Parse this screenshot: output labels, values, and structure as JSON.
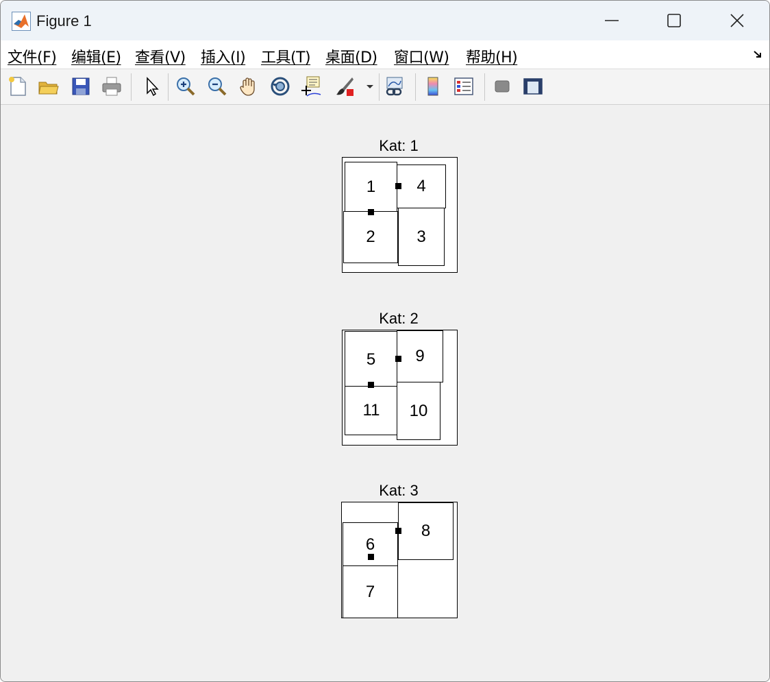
{
  "window": {
    "title": "Figure 1"
  },
  "menu": [
    {
      "id": "file",
      "label": "文件(F)"
    },
    {
      "id": "edit",
      "label": "编辑(E)"
    },
    {
      "id": "view",
      "label": "查看(V)"
    },
    {
      "id": "insert",
      "label": "插入(I)"
    },
    {
      "id": "tools",
      "label": "工具(T)"
    },
    {
      "id": "desktop",
      "label": "桌面(D)"
    },
    {
      "id": "window",
      "label": "窗口(W)"
    },
    {
      "id": "help",
      "label": "帮助(H)"
    }
  ],
  "toolbar_icons": [
    "new-figure-icon",
    "open-file-icon",
    "save-icon",
    "print-icon",
    "edit-plot-arrow-icon",
    "zoom-in-icon",
    "zoom-out-icon",
    "pan-hand-icon",
    "rotate-3d-icon",
    "data-cursor-icon",
    "brush-icon",
    "brush-dropdown-icon",
    "link-plot-icon",
    "colorbar-icon",
    "legend-icon",
    "hide-plot-tools-icon",
    "show-plot-tools-icon"
  ],
  "colors": {
    "titlebar": "#eef3f8",
    "canvas": "#f0f0f0",
    "brush_red": "#e02020"
  },
  "panels": [
    {
      "title": "Kat: 1",
      "tiles": [
        "1",
        "4",
        "2",
        "3"
      ]
    },
    {
      "title": "Kat: 2",
      "tiles": [
        "5",
        "9",
        "11",
        "10"
      ]
    },
    {
      "title": "Kat: 3",
      "tiles": [
        "8",
        "6",
        "7"
      ]
    }
  ]
}
